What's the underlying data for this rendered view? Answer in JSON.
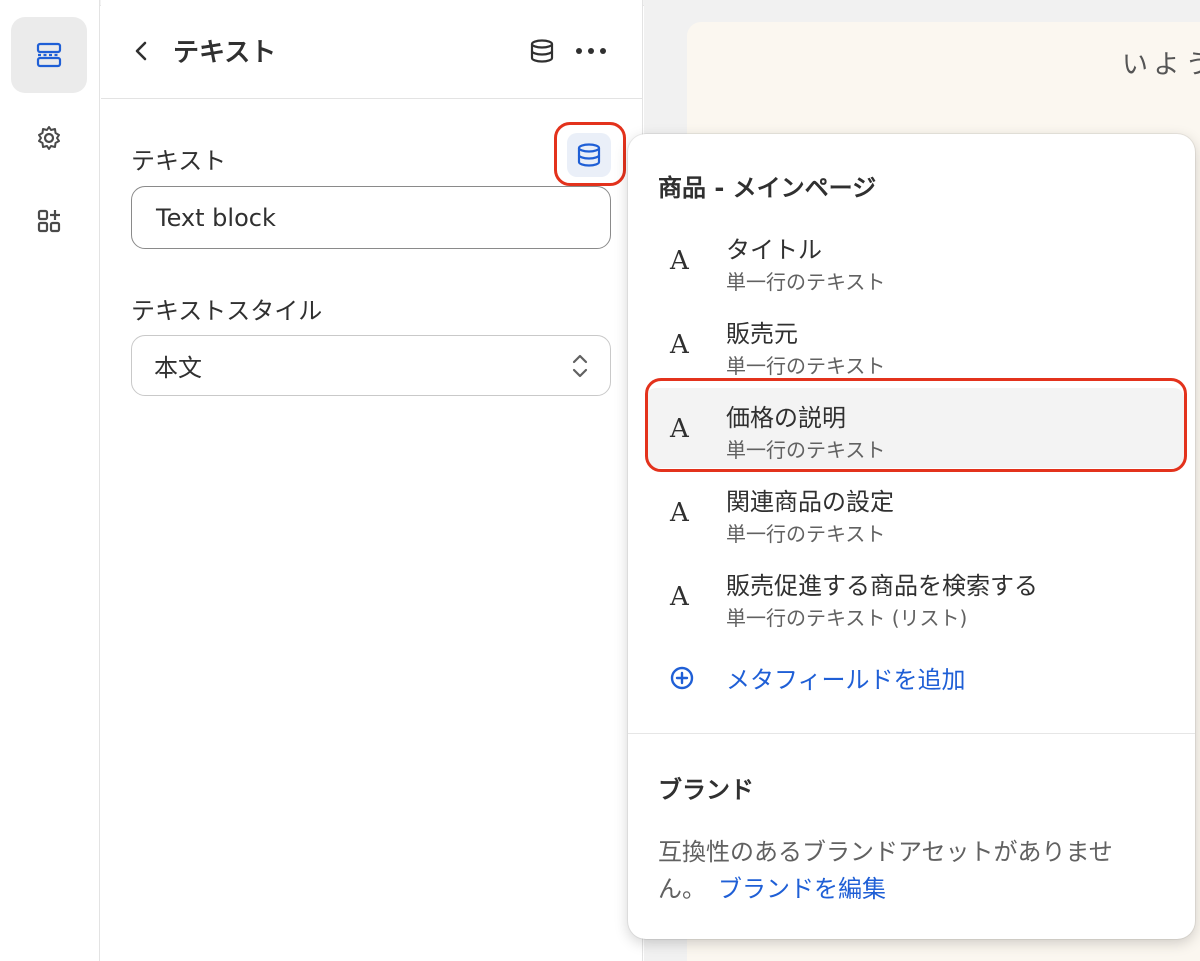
{
  "panel": {
    "title": "テキスト",
    "fields": {
      "text_label": "テキスト",
      "text_value": "Text block",
      "style_label": "テキストスタイル",
      "style_value": "本文"
    }
  },
  "rail": {
    "items": [
      {
        "icon": "sections-icon",
        "active": true
      },
      {
        "icon": "gear-icon",
        "active": false
      },
      {
        "icon": "apps-icon",
        "active": false
      }
    ]
  },
  "preview": {
    "heading_fragment": "いよう"
  },
  "popover": {
    "section_title": "商品 - メインページ",
    "items": [
      {
        "glyph": "A",
        "name": "タイトル",
        "type": "単一行のテキスト"
      },
      {
        "glyph": "A",
        "name": "販売元",
        "type": "単一行のテキスト"
      },
      {
        "glyph": "A",
        "name": "価格の説明",
        "type": "単一行のテキスト"
      },
      {
        "glyph": "A",
        "name": "関連商品の設定",
        "type": "単一行のテキスト"
      },
      {
        "glyph": "A",
        "name": "販売促進する商品を検索する",
        "type": "単一行のテキスト (リスト)"
      }
    ],
    "add_metafield": "メタフィールドを追加",
    "brand_title": "ブランド",
    "brand_note": "互換性のあるブランドアセットがありません。",
    "brand_link": "ブランドを編集"
  },
  "colors": {
    "accent_blue": "#1f5fd6",
    "highlight_red": "#e3321c",
    "text": "#303030",
    "muted_text": "#616161"
  }
}
